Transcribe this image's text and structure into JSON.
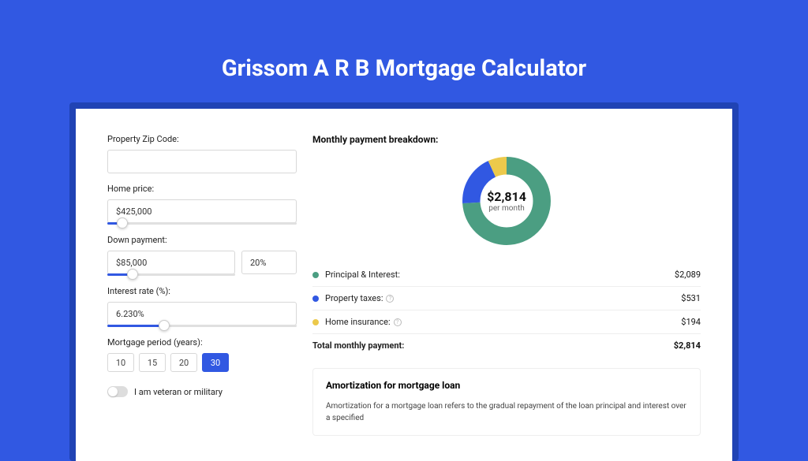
{
  "title": "Grissom A R B Mortgage Calculator",
  "form": {
    "zip": {
      "label": "Property Zip Code:",
      "value": ""
    },
    "price": {
      "label": "Home price:",
      "value": "$425,000",
      "slider_pct": 8
    },
    "down": {
      "label": "Down payment:",
      "value": "$85,000",
      "pct_value": "20%",
      "slider_pct": 20
    },
    "rate": {
      "label": "Interest rate (%):",
      "value": "6.230%",
      "slider_pct": 30
    },
    "period": {
      "label": "Mortgage period (years):",
      "options": [
        "10",
        "15",
        "20",
        "30"
      ],
      "selected": "30"
    },
    "veteran": {
      "label": "I am veteran or military",
      "on": false
    }
  },
  "breakdown": {
    "title": "Monthly payment breakdown:",
    "center_value": "$2,814",
    "center_sub": "per month",
    "items": [
      {
        "label": "Principal & Interest:",
        "value": "$2,089",
        "color": "#4b9e82",
        "pct": 74,
        "info": false
      },
      {
        "label": "Property taxes:",
        "value": "$531",
        "color": "#3158e2",
        "pct": 19,
        "info": true
      },
      {
        "label": "Home insurance:",
        "value": "$194",
        "color": "#ecc94b",
        "pct": 7,
        "info": true
      }
    ],
    "total_label": "Total monthly payment:",
    "total_value": "$2,814"
  },
  "amort": {
    "title": "Amortization for mortgage loan",
    "text": "Amortization for a mortgage loan refers to the gradual repayment of the loan principal and interest over a specified"
  },
  "chart_data": {
    "type": "pie",
    "title": "Monthly payment breakdown",
    "categories": [
      "Principal & Interest",
      "Property taxes",
      "Home insurance"
    ],
    "values": [
      2089,
      531,
      194
    ],
    "colors": [
      "#4b9e82",
      "#3158e2",
      "#ecc94b"
    ],
    "total": 2814,
    "unit": "USD/month"
  }
}
